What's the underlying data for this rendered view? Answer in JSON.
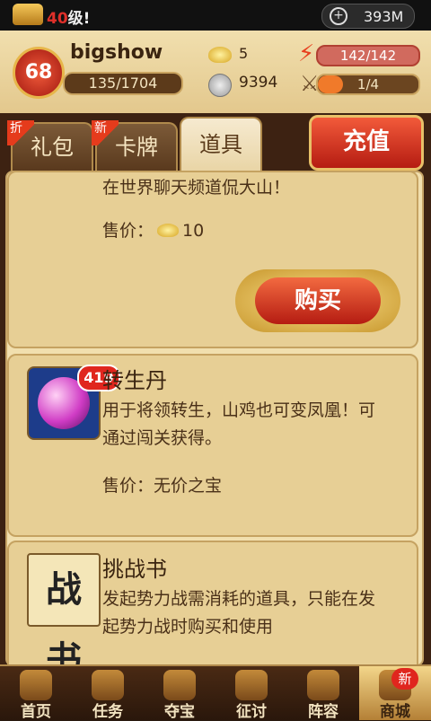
{
  "status_bar": {
    "level_number": "40",
    "level_suffix": "级!",
    "memory": "393M"
  },
  "player": {
    "level": "68",
    "name": "bigshow",
    "exp": "135/1704",
    "gold": "5",
    "silver": "9394",
    "energy": "142/142",
    "battle": "1/4",
    "battle_fraction": 0.25
  },
  "tabs": [
    {
      "label": "礼包",
      "flag": "折"
    },
    {
      "label": "卡牌",
      "flag": "新"
    },
    {
      "label": "道具",
      "flag": ""
    }
  ],
  "recharge_label": "充值",
  "items": [
    {
      "desc_tail": "在世界聊天频道侃大山！",
      "price_label": "售价：",
      "price_value": "10",
      "buy_label": "购买"
    },
    {
      "title": "转生丹",
      "badge": "419",
      "desc": "用于将领转生，山鸡也可变凤凰！可通过闯关获得。",
      "price_label": "售价：",
      "price_value": "无价之宝"
    },
    {
      "title": "挑战书",
      "icon_text": "战书",
      "desc": "发起势力战需消耗的道具，只能在发起势力战时购买和使用"
    }
  ],
  "nav": [
    {
      "label": "首页"
    },
    {
      "label": "任务"
    },
    {
      "label": "夺宝"
    },
    {
      "label": "征讨"
    },
    {
      "label": "阵容"
    },
    {
      "label": "商城",
      "badge": "新"
    }
  ]
}
